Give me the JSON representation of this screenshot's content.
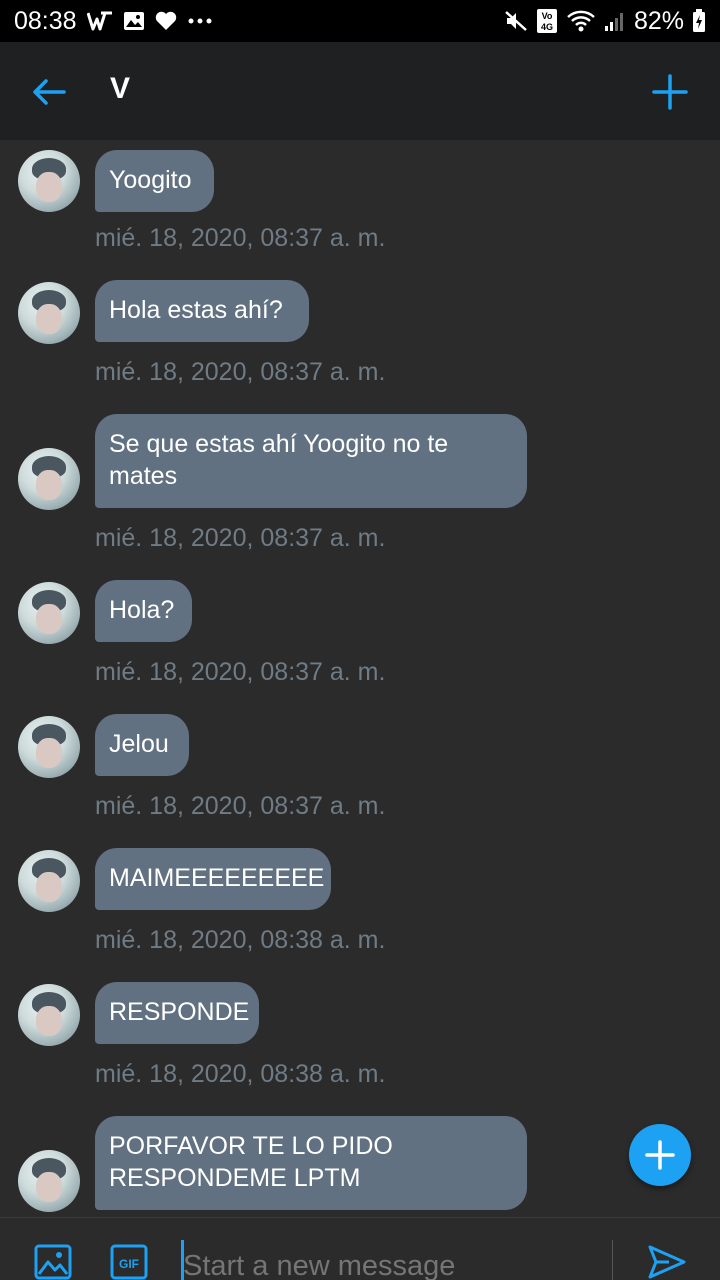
{
  "status_bar": {
    "time": "08:38",
    "battery": "82%",
    "network_badge_top": "Vo)",
    "network_badge_bottom": "4G"
  },
  "header": {
    "title": "V"
  },
  "messages": [
    {
      "text": "Yoogito",
      "time": "mié. 18, 2020, 08:37 a. m."
    },
    {
      "text": "Hola estas ahí?",
      "time": "mié. 18, 2020, 08:37 a. m."
    },
    {
      "text": "Se que estas ahí Yoogito no te mates",
      "time": "mié. 18, 2020, 08:37 a. m."
    },
    {
      "text": "Hola?",
      "time": "mié. 18, 2020, 08:37 a. m."
    },
    {
      "text": "Jelou",
      "time": "mié. 18, 2020, 08:37 a. m."
    },
    {
      "text": "MAIMEEEEEEEEE",
      "time": "mié. 18, 2020, 08:38 a. m."
    },
    {
      "text": "RESPONDE",
      "time": "mié. 18, 2020, 08:38 a. m."
    },
    {
      "text": "PORFAVOR TE LO PIDO RESPONDEME LPTM",
      "time": ""
    }
  ],
  "composer": {
    "placeholder": "Start a new message",
    "gif_label": "GIF"
  },
  "colors": {
    "accent": "#1da1f2",
    "bubble": "#627181",
    "background": "#2b2b2c",
    "header": "#1f2021",
    "timestamp": "#6f7b85"
  }
}
